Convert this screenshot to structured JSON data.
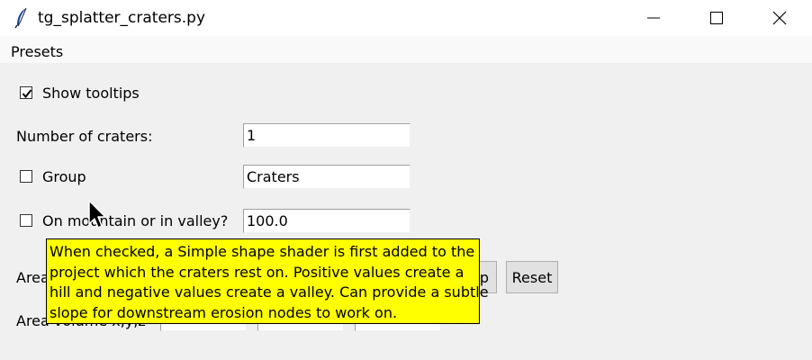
{
  "window": {
    "title": "tg_splatter_craters.py",
    "app_icon": "feather-icon",
    "controls": [
      "minimize-icon",
      "maximize-icon",
      "close-icon"
    ]
  },
  "menu": {
    "items": [
      "Presets"
    ]
  },
  "form": {
    "show_tooltips": {
      "label": "Show tooltips",
      "checked": true
    },
    "num_craters": {
      "label": "Number of craters:",
      "value": "1"
    },
    "group": {
      "label": "Group",
      "checked": false,
      "value": "Craters"
    },
    "on_mountain": {
      "label": "On mountain or in valley?",
      "checked": false,
      "value": "100.0"
    },
    "area_row1": {
      "label_partial": "Area",
      "button_partial": "p",
      "reset_label": "Reset"
    },
    "area_row2": {
      "label_partial": "Area volume x,y,z"
    }
  },
  "tooltip": {
    "lines": [
      "When checked, a Simple shape shader is first added to the",
      "project which the craters rest on. Positive values create a",
      "hill and negative values create a valley. Can provide a subtle",
      "slope for downstream erosion nodes to work on."
    ],
    "background": "#ffff00"
  }
}
